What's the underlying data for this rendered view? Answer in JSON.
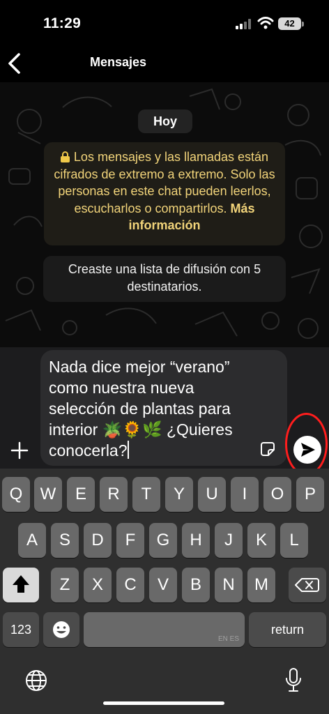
{
  "status_bar": {
    "time": "11:29",
    "battery": "42"
  },
  "header": {
    "title": "Mensajes",
    "back_icon": "chevron-left-icon"
  },
  "chat": {
    "date_label": "Hoy",
    "encryption_notice": {
      "lock_icon": "lock-icon",
      "text": "Los mensajes y las llamadas están cifrados de extremo a extremo. Solo las personas en este chat pueden leerlos, escucharlos o compartirlos.",
      "link": "Más información",
      "text_color": "#f2d47a"
    },
    "system_message": "Creaste una lista de difusión con 5 destinatarios."
  },
  "composer": {
    "message": "Nada dice mejor “verano” como nuestra nueva selección de plantas para interior 🪴🌻🌿 ¿Quieres conocerla?",
    "add_icon": "plus-icon",
    "sticker_icon": "sticker-icon",
    "send_icon": "send-icon",
    "annotation": "red-circle-highlight"
  },
  "keyboard": {
    "row1": [
      "Q",
      "W",
      "E",
      "R",
      "T",
      "Y",
      "U",
      "I",
      "O",
      "P"
    ],
    "row2": [
      "A",
      "S",
      "D",
      "F",
      "G",
      "H",
      "J",
      "K",
      "L"
    ],
    "row3": [
      "Z",
      "X",
      "C",
      "V",
      "B",
      "N",
      "M"
    ],
    "numbers_key": "123",
    "space_language": "EN ES",
    "return_key": "return",
    "icons": {
      "shift": "shift-icon",
      "delete": "backspace-icon",
      "emoji": "emoji-icon",
      "globe": "globe-icon",
      "microphone": "microphone-icon"
    }
  },
  "colors": {
    "app_background": "#000000",
    "composer_background": "#1c1c1e",
    "keyboard_background": "#2f2f2f",
    "send_button": "#ffffff",
    "annotation": "#ff1d1d"
  }
}
